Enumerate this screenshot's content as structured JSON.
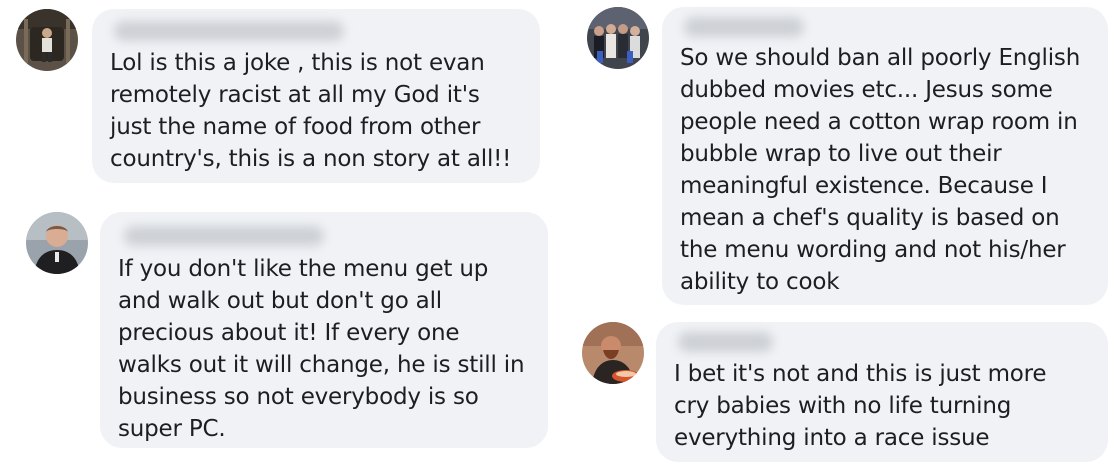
{
  "comments": [
    {
      "avatar": "user-avatar-photo",
      "text": "Lol is this a joke , this is not evan\nremotely racist at all my God it's\njust the name of food from other\ncountry's, this is a non story at all!!"
    },
    {
      "avatar": "user-avatar-photo",
      "text": "If you don't like the menu get up\nand walk out but don't go all\nprecious about it!  If every one\nwalks out it will change, he is still in\nbusiness so not everybody is so\nsuper PC."
    },
    {
      "avatar": "user-avatar-group-photo",
      "text": "So we should ban all poorly English\ndubbed movies etc... Jesus some\npeople need a cotton wrap room in\nbubble wrap to live out their\nmeaningful existence. Because I\nmean a chef's quality is based on\nthe menu wording and not his/her\nability to cook"
    },
    {
      "avatar": "user-avatar-photo",
      "text": "I bet it's not and this is just more\ncry babies with no life turning\neverything into a race issue"
    }
  ],
  "colors": {
    "bubble_background": "#f0f2f5",
    "text": "#1c1e21",
    "blurred_name": "#c8cbd0"
  }
}
